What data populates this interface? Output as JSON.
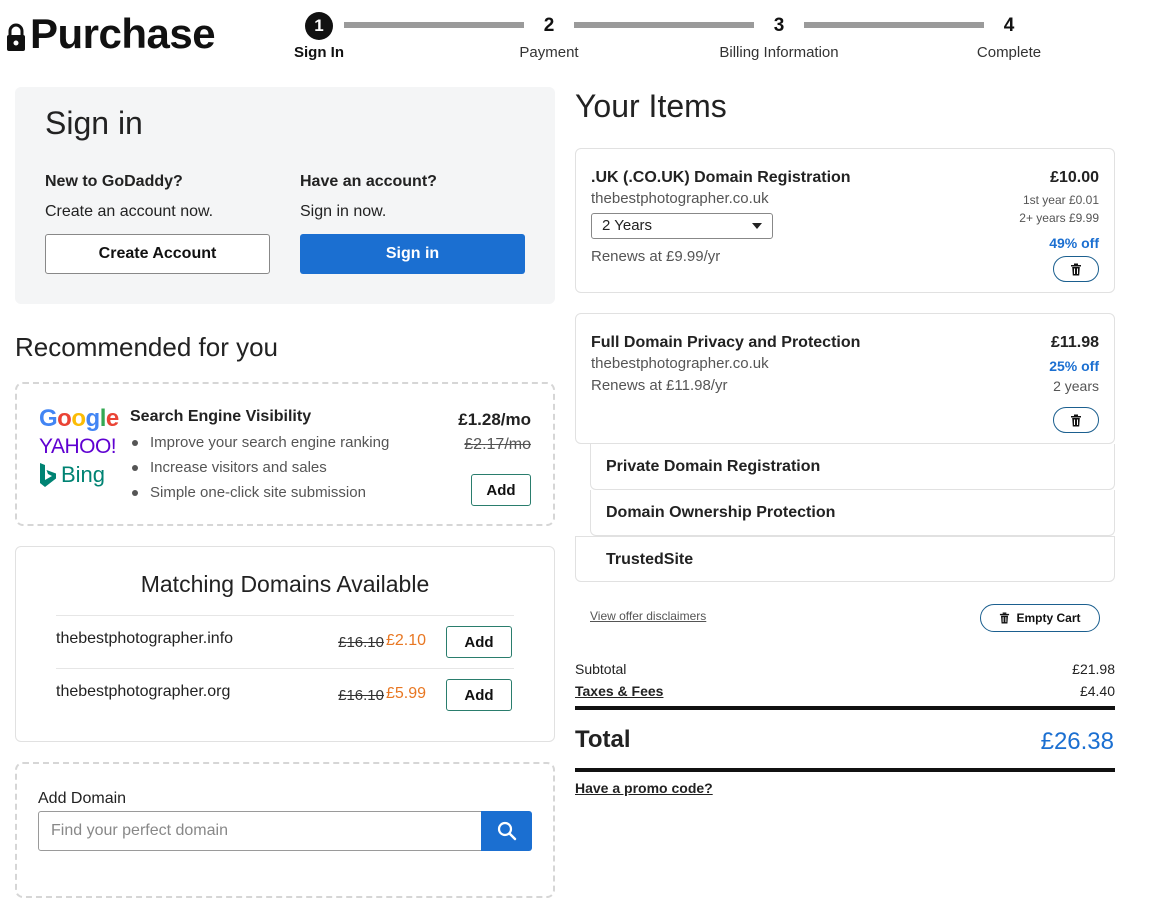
{
  "header": {
    "title": "Purchase",
    "steps": [
      {
        "num": "1",
        "label": "Sign In"
      },
      {
        "num": "2",
        "label": "Payment"
      },
      {
        "num": "3",
        "label": "Billing Information"
      },
      {
        "num": "4",
        "label": "Complete"
      }
    ]
  },
  "signin": {
    "title": "Sign in",
    "new_heading": "New to GoDaddy?",
    "new_text": "Create an account now.",
    "create_button": "Create Account",
    "have_heading": "Have an account?",
    "have_text": "Sign in now.",
    "signin_button": "Sign in"
  },
  "recommended": {
    "title": "Recommended for you",
    "seo": {
      "logos": {
        "google": "Google",
        "yahoo": "YAHOO!",
        "bing": "Bing"
      },
      "title": "Search Engine Visibility",
      "bullets": [
        "Improve your search engine ranking",
        "Increase visitors and sales",
        "Simple one-click site submission"
      ],
      "price": "£1.28/mo",
      "old_price": "£2.17/mo",
      "add_label": "Add"
    }
  },
  "matching": {
    "title": "Matching Domains Available",
    "domains": [
      {
        "name": "thebestphotographer.info",
        "old_price": "£16.10",
        "price": "£2.10",
        "add_label": "Add"
      },
      {
        "name": "thebestphotographer.org",
        "old_price": "£16.10",
        "price": "£5.99",
        "add_label": "Add"
      }
    ]
  },
  "add_domain": {
    "label": "Add Domain",
    "placeholder": "Find your perfect domain"
  },
  "cart": {
    "title": "Your Items",
    "items": [
      {
        "name": ".UK (.CO.UK) Domain Registration",
        "domain": "thebestphotographer.co.uk",
        "term": "2 Years",
        "renews": "Renews at £9.99/yr",
        "price": "£10.00",
        "first_year": "1st year £0.01",
        "later_years": "2+ years £9.99",
        "discount": "49% off"
      },
      {
        "name": "Full Domain Privacy and Protection",
        "domain": "thebestphotographer.co.uk",
        "renews": "Renews at £11.98/yr",
        "price": "£11.98",
        "discount": "25% off",
        "term": "2 years",
        "sub_items": [
          "Private Domain Registration",
          "Domain Ownership Protection",
          "TrustedSite"
        ]
      }
    ],
    "disclaimer_link": "View offer disclaimers",
    "empty_cart": "Empty Cart",
    "subtotal_label": "Subtotal",
    "subtotal": "£21.98",
    "taxes_label": "Taxes & Fees",
    "taxes": "£4.40",
    "total_label": "Total",
    "total": "£26.38",
    "promo_link": "Have a promo code?"
  },
  "colors": {
    "primary": "#1b6fd1",
    "sale": "#e87722",
    "card_bg": "#f4f5f6"
  }
}
